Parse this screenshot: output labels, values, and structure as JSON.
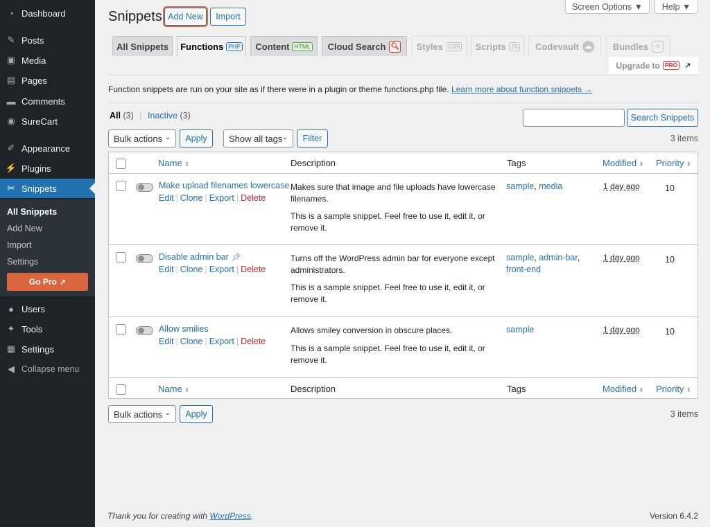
{
  "sidebar": {
    "items": [
      {
        "label": "Dashboard",
        "icon": "dashboard-icon"
      },
      {
        "label": "Posts",
        "icon": "pin-icon"
      },
      {
        "label": "Media",
        "icon": "media-icon"
      },
      {
        "label": "Pages",
        "icon": "pages-icon"
      },
      {
        "label": "Comments",
        "icon": "comment-icon"
      },
      {
        "label": "SureCart",
        "icon": "surecart-icon"
      },
      {
        "label": "Appearance",
        "icon": "brush-icon"
      },
      {
        "label": "Plugins",
        "icon": "plug-icon"
      },
      {
        "label": "Snippets",
        "icon": "scissors-icon"
      },
      {
        "label": "Users",
        "icon": "user-icon"
      },
      {
        "label": "Tools",
        "icon": "wrench-icon"
      },
      {
        "label": "Settings",
        "icon": "settings-icon"
      },
      {
        "label": "Collapse menu",
        "icon": "collapse-icon"
      }
    ],
    "submenu": [
      "All Snippets",
      "Add New",
      "Import",
      "Settings"
    ],
    "go_pro": "Go Pro"
  },
  "top_buttons": {
    "screen_options": "Screen Options ▼",
    "help": "Help ▼"
  },
  "header": {
    "title": "Snippets",
    "add_new": "Add New",
    "import": "Import"
  },
  "tabs": [
    {
      "label": "All Snippets",
      "badge": ""
    },
    {
      "label": "Functions",
      "badge": "PHP"
    },
    {
      "label": "Content",
      "badge": "HTML"
    },
    {
      "label": "Cloud Search",
      "badge": ""
    },
    {
      "label": "Styles",
      "badge": "CSS"
    },
    {
      "label": "Scripts",
      "badge": "JS"
    },
    {
      "label": "Codevault",
      "badge": ""
    },
    {
      "label": "Bundles",
      "badge": ""
    }
  ],
  "upgrade": {
    "label": "Upgrade to",
    "badge": "PRO"
  },
  "info": {
    "text": "Function snippets are run on your site as if there were in a plugin or theme functions.php file.",
    "link": "Learn more about function snippets →"
  },
  "filters": {
    "all": "All",
    "all_count": "(3)",
    "sep": "|",
    "inactive": "Inactive",
    "inactive_count": "(3)",
    "search_button": "Search Snippets",
    "bulk_actions": "Bulk actions",
    "apply": "Apply",
    "tags_select": "Show all tags",
    "filter": "Filter",
    "items_count": "3 items"
  },
  "table": {
    "columns": {
      "name": "Name",
      "description": "Description",
      "tags": "Tags",
      "modified": "Modified",
      "priority": "Priority"
    },
    "action_labels": {
      "edit": "Edit",
      "clone": "Clone",
      "export": "Export",
      "delete": "Delete",
      "sep": "|"
    },
    "rows": [
      {
        "name": "Make upload filenames lowercase",
        "desc1": "Makes sure that image and file uploads have lowercase filenames.",
        "desc2": "This is a sample snippet. Feel free to use it, edit it, or remove it.",
        "tags": [
          "sample",
          "media"
        ],
        "modified": "1 day ago",
        "priority": "10"
      },
      {
        "name": "Disable admin bar",
        "desc1": "Turns off the WordPress admin bar for everyone except administrators.",
        "desc2": "This is a sample snippet. Feel free to use it, edit it, or remove it.",
        "tags": [
          "sample",
          "admin-bar",
          "front-end"
        ],
        "modified": "1 day ago",
        "priority": "10"
      },
      {
        "name": "Allow smilies",
        "desc1": "Allows smiley conversion in obscure places.",
        "desc2": "This is a sample snippet. Feel free to use it, edit it, or remove it.",
        "tags": [
          "sample"
        ],
        "modified": "1 day ago",
        "priority": "10"
      }
    ]
  },
  "footer": {
    "thanks": "Thank you for creating with",
    "wp_link": "WordPress",
    "dot": ".",
    "version": "Version 6.4.2"
  },
  "colors": {
    "accent": "#2271b1",
    "sidebar_bg": "#1d2327",
    "active_menu": "#2271b1",
    "go_pro": "#d9663f",
    "delete": "#b32d2e"
  }
}
